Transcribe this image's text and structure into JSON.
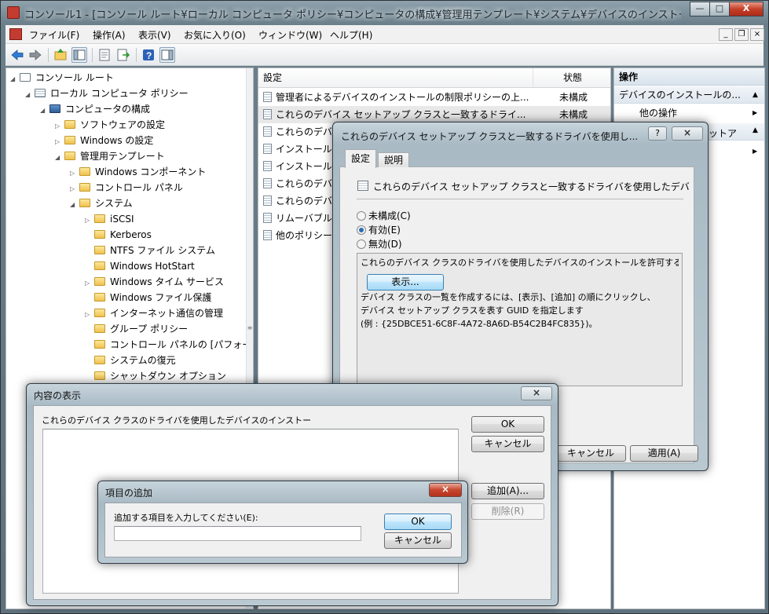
{
  "main": {
    "title": "コンソール1 - [コンソール ルート¥ローカル コンピュータ ポリシー¥コンピュータの構成¥管理用テンプレート¥システム¥デバイスのインストール¥デバ...",
    "minimize_label": "—",
    "maximize_label": "□",
    "close_label": "X"
  },
  "menu": {
    "items": [
      "ファイル(F)",
      "操作(A)",
      "表示(V)",
      "お気に入り(O)",
      "ウィンドウ(W)",
      "ヘルプ(H)"
    ],
    "mdi_min": "_",
    "mdi_restore": "❐",
    "mdi_close": "×"
  },
  "toolbar": {
    "icons": [
      "back-arrow-icon",
      "forward-arrow-icon",
      "up-folder-icon",
      "show-hide-tree-icon",
      "properties-icon",
      "export-list-icon",
      "help-icon",
      "show-hide-action-pane-icon"
    ]
  },
  "tree": {
    "items": [
      {
        "label": "コンソール ルート",
        "expanded": true
      },
      {
        "label": "ローカル コンピュータ ポリシー",
        "expanded": true
      },
      {
        "label": "コンピュータの構成",
        "expanded": true
      },
      {
        "label": "ソフトウェアの設定",
        "expanded": false
      },
      {
        "label": "Windows の設定",
        "expanded": false
      },
      {
        "label": "管理用テンプレート",
        "expanded": true
      },
      {
        "label": "Windows コンポーネント",
        "expanded": false
      },
      {
        "label": "コントロール パネル",
        "expanded": false
      },
      {
        "label": "システム",
        "expanded": true
      },
      {
        "label": "iSCSI",
        "expanded": false
      },
      {
        "label": "Kerberos",
        "expanded": null
      },
      {
        "label": "NTFS ファイル システム",
        "expanded": null
      },
      {
        "label": "Windows HotStart",
        "expanded": null
      },
      {
        "label": "Windows タイム サービス",
        "expanded": false
      },
      {
        "label": "Windows ファイル保護",
        "expanded": null
      },
      {
        "label": "インターネット通信の管理",
        "expanded": false
      },
      {
        "label": "グループ ポリシー",
        "expanded": null
      },
      {
        "label": "コントロール パネルの [パフォー",
        "expanded": null
      },
      {
        "label": "システムの復元",
        "expanded": null
      },
      {
        "label": "シャットダウン オプション",
        "expanded": null
      }
    ]
  },
  "list": {
    "col_setting": "設定",
    "col_state": "状態",
    "rows": [
      {
        "name": "管理者によるデバイスのインストールの制限ポリシーの上...",
        "state": "未構成"
      },
      {
        "name": "これらのデバイス セットアップ クラスと一致するドライ...",
        "state": "未構成"
      },
      {
        "name": "これらのデバ",
        "state": ""
      },
      {
        "name": "インストール",
        "state": ""
      },
      {
        "name": "インストール",
        "state": ""
      },
      {
        "name": "これらのデバ",
        "state": ""
      },
      {
        "name": "これらのデバ",
        "state": ""
      },
      {
        "name": "リムーバブル",
        "state": ""
      },
      {
        "name": "他のポリシー",
        "state": ""
      }
    ]
  },
  "actions": {
    "header": "操作",
    "group": "デバイスのインストールの...",
    "group_item": "他の操作",
    "selected_suffix": "ットア"
  },
  "policy_dialog": {
    "title": "これらのデバイス セットアップ クラスと一致するドライバを使用し...",
    "help_label": "?",
    "close_label": "×",
    "tabs": [
      "設定",
      "説明"
    ],
    "policy_name": "これらのデバイス セットアップ クラスと一致するドライバを使用したデバイスのインスト...",
    "options": [
      "未構成(C)",
      "有効(E)",
      "無効(D)"
    ],
    "selected_option": 1,
    "options_label": "これらのデバイス クラスのドライバを使用したデバイスのインストールを許可する:",
    "show_button": "表示...",
    "help_lines": [
      "デバイス クラスの一覧を作成するには、[表示]、[追加] の順にクリックし、",
      "デバイス セットアップ クラスを表す GUID を指定します",
      "(例 : {25DBCE51-6C8F-4A72-8A6D-B54C2B4FC835})。"
    ],
    "cancel_button": "キャンセル",
    "apply_button": "適用(A)"
  },
  "contents_dialog": {
    "title": "内容の表示",
    "close_label": "×",
    "label": "これらのデバイス クラスのドライバを使用したデバイスのインストー",
    "ok_button": "OK",
    "cancel_button": "キャンセル",
    "add_button": "追加(A)...",
    "remove_button": "削除(R)"
  },
  "add_dialog": {
    "title": "項目の追加",
    "close_label": "×",
    "prompt": "追加する項目を入力してください(E):",
    "input_value": "",
    "ok_button": "OK",
    "cancel_button": "キャンセル"
  }
}
